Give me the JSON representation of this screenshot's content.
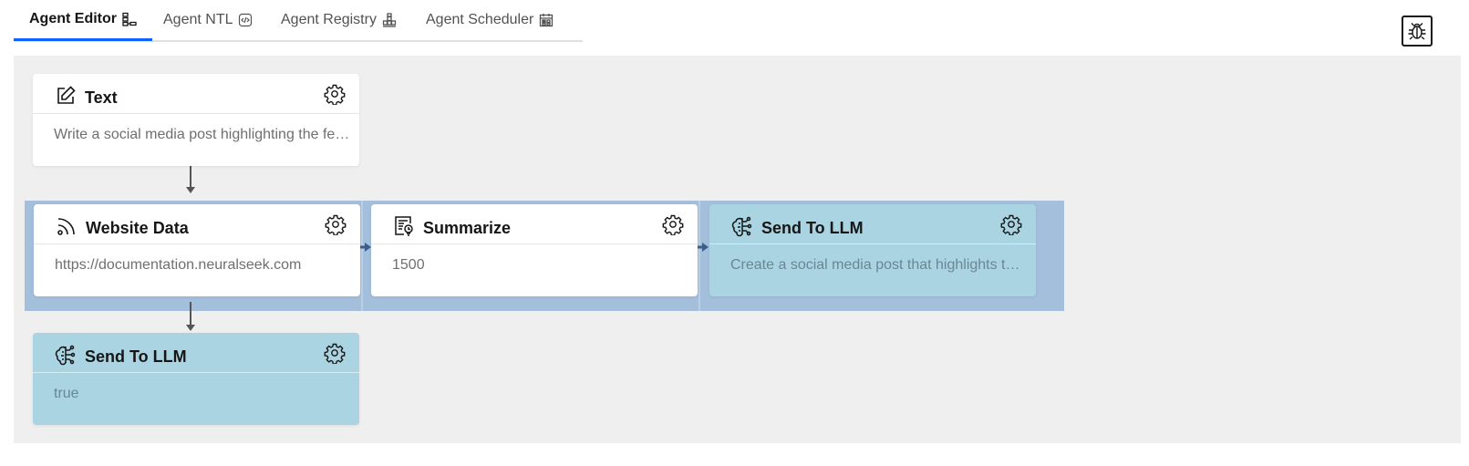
{
  "tabs": [
    {
      "label": "Agent Editor",
      "icon": "flow-icon",
      "active": true
    },
    {
      "label": "Agent NTL",
      "icon": "code-icon",
      "active": false
    },
    {
      "label": "Agent Registry",
      "icon": "registry-icon",
      "active": false
    },
    {
      "label": "Agent Scheduler",
      "icon": "calendar-icon",
      "active": false
    }
  ],
  "debug_button": {
    "icon": "bug-icon"
  },
  "nodes": {
    "text": {
      "title": "Text",
      "body": "Write a social media post highlighting the features of NeuralSeek",
      "icon": "edit-icon"
    },
    "website": {
      "title": "Website Data",
      "body": "https://documentation.neuralseek.com",
      "icon": "rss-icon"
    },
    "summarize": {
      "title": "Summarize",
      "body": "1500",
      "icon": "summary-icon"
    },
    "llm_right": {
      "title": "Send To LLM",
      "body": "Create a social media post that highlights the key features",
      "icon": "ai-brain-icon"
    },
    "llm_bottom": {
      "title": "Send To LLM",
      "body": "true",
      "icon": "ai-brain-icon"
    }
  },
  "colors": {
    "accent": "#0f62fe",
    "canvas": "#efefef",
    "group": "#a3bfdc",
    "llm_node": "#aad4e2"
  }
}
